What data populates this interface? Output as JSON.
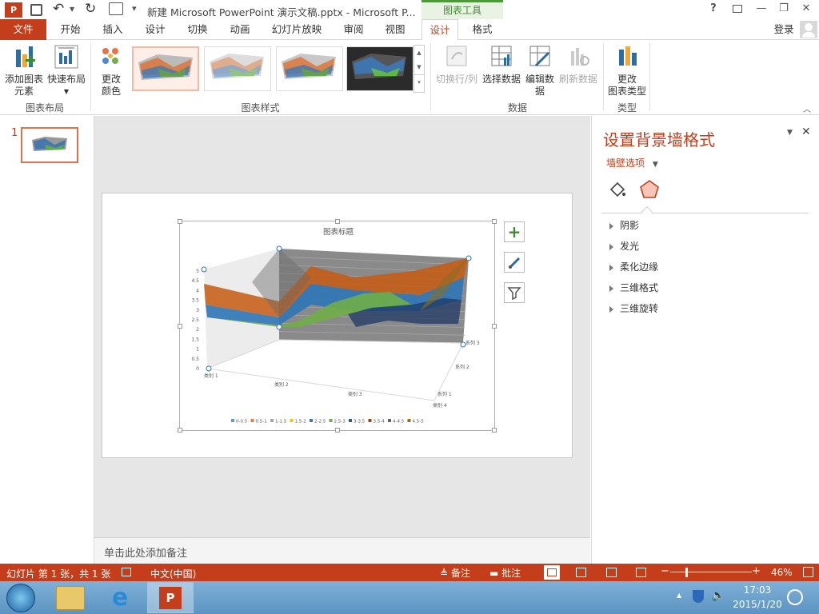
{
  "titlebar": {
    "title": "新建 Microsoft PowerPoint 演示文稿.pptx - Microsoft P...",
    "context_tab": "图表工具",
    "help": "?",
    "minimize": "—",
    "restore": "❐",
    "close": "✕"
  },
  "tabs": {
    "file": "文件",
    "items": [
      "开始",
      "插入",
      "设计",
      "切换",
      "动画",
      "幻灯片放映",
      "审阅",
      "视图",
      "设计",
      "格式"
    ],
    "login": "登录"
  },
  "ribbon": {
    "add_element_1": "添加图表",
    "add_element_2": "元素",
    "quick_layout": "快速布局",
    "group_layout": "图表布局",
    "change_color_1": "更改",
    "change_color_2": "颜色",
    "group_styles": "图表样式",
    "switch_rowcol": "切换行/列",
    "select_data": "选择数据",
    "edit_data_1": "编辑数",
    "edit_data_2": "据",
    "refresh_data": "刷新数据",
    "group_data": "数据",
    "change_type_1": "更改",
    "change_type_2": "图表类型",
    "group_type": "类型"
  },
  "thumbs": {
    "slide_number": "1"
  },
  "chart": {
    "title": "图表标题",
    "series_labels": [
      "系列 3",
      "系列 2",
      "系列 1"
    ],
    "legend": [
      "0-0.5",
      "0.5-1",
      "1-1.5",
      "1.5-2",
      "2-2.5",
      "2.5-3",
      "3-3.5",
      "3.5-4",
      "4-4.5",
      "4.5-5"
    ],
    "legend_colors": [
      "#5b9bd5",
      "#ed7d31",
      "#a5a5a5",
      "#ffc000",
      "#4472c4",
      "#70ad47",
      "#255e91",
      "#9e480e",
      "#636363",
      "#997300"
    ]
  },
  "chart_data": {
    "type": "surface",
    "title": "图表标题",
    "categories": [
      "类别 1",
      "类别 2",
      "类别 3",
      "类别 4"
    ],
    "series_names": [
      "系列 1",
      "系列 2",
      "系列 3"
    ],
    "series": [
      {
        "name": "系列 1",
        "values": [
          4.3,
          2.5,
          3.5,
          4.5
        ]
      },
      {
        "name": "系列 2",
        "values": [
          2.4,
          4.4,
          1.8,
          2.8
        ]
      },
      {
        "name": "系列 3",
        "values": [
          2.0,
          2.0,
          3.0,
          5.0
        ]
      }
    ],
    "z_ticks": [
      "0",
      "0.5",
      "1",
      "1.5",
      "2",
      "2.5",
      "3",
      "3.5",
      "4",
      "4.5",
      "5"
    ],
    "zlim": [
      0,
      5
    ],
    "legend_position": "bottom",
    "legend": [
      "0-0.5",
      "0.5-1",
      "1-1.5",
      "1.5-2",
      "2-2.5",
      "2.5-3",
      "3-3.5",
      "3.5-4",
      "4-4.5",
      "4.5-5"
    ]
  },
  "notes": {
    "placeholder": "单击此处添加备注"
  },
  "pane": {
    "title": "设置背景墙格式",
    "options": "墙壁选项",
    "items": [
      "阴影",
      "发光",
      "柔化边缘",
      "三维格式",
      "三维旋转"
    ]
  },
  "status": {
    "slide_info": "幻灯片 第 1 张，共 1 张",
    "language": "中文(中国)",
    "notes": "备注",
    "comments": "批注",
    "zoom": "46%"
  },
  "taskbar": {
    "time": "17:03",
    "date": "2015/1/20"
  }
}
